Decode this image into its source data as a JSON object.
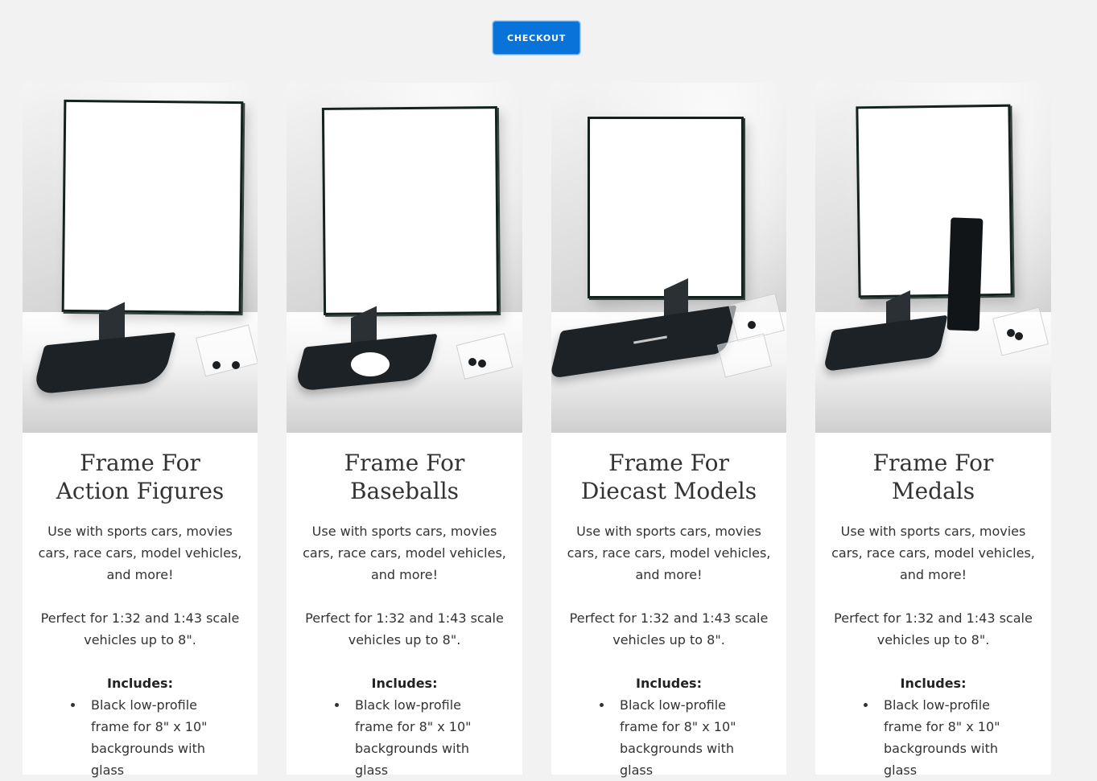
{
  "header": {
    "checkout_label": "CHECKOUT"
  },
  "products": [
    {
      "title_line1": "Frame For",
      "title_line2": "Action Figures",
      "description": "Use with sports cars, movies cars, race cars, model vehicles, and more!",
      "scale_note": "Perfect for 1:32 and 1:43 scale vehicles up to 8\".",
      "includes_label": "Includes:",
      "includes": [
        "Black low-profile frame for 8\" x 10\" backgrounds with glass"
      ]
    },
    {
      "title_line1": "Frame For",
      "title_line2": "Baseballs",
      "description": "Use with sports cars, movies cars, race cars, model vehicles, and more!",
      "scale_note": "Perfect for 1:32 and 1:43 scale vehicles up to 8\".",
      "includes_label": "Includes:",
      "includes": [
        "Black low-profile frame for 8\" x 10\" backgrounds with glass"
      ]
    },
    {
      "title_line1": "Frame For",
      "title_line2": "Diecast Models",
      "description": "Use with sports cars, movies cars, race cars, model vehicles, and more!",
      "scale_note": "Perfect for 1:32 and 1:43 scale vehicles up to 8\".",
      "includes_label": "Includes:",
      "includes": [
        "Black low-profile frame for 8\" x 10\" backgrounds with glass"
      ]
    },
    {
      "title_line1": "Frame For",
      "title_line2": "Medals",
      "description": "Use with sports cars, movies cars, race cars, model vehicles, and more!",
      "scale_note": "Perfect for 1:32 and 1:43 scale vehicles up to 8\".",
      "includes_label": "Includes:",
      "includes": [
        "Black low-profile frame for 8\" x 10\" backgrounds with glass"
      ]
    }
  ],
  "colors": {
    "page_background": "#f2f2f2",
    "checkout_button": "#0a73d9",
    "card_background": "#ffffff",
    "text": "#333333"
  }
}
